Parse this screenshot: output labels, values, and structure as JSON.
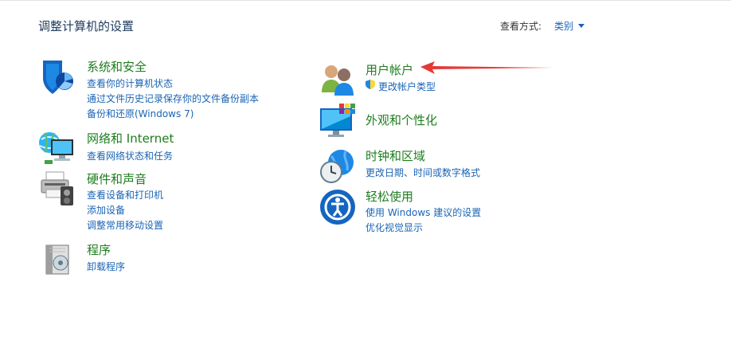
{
  "header": {
    "title": "调整计算机的设置",
    "view_by_label": "查看方式:",
    "view_by_value": "类别"
  },
  "categories": [
    {
      "title": "系统和安全",
      "icon": "shield-icon",
      "links": [
        "查看你的计算机状态",
        "通过文件历史记录保存你的文件备份副本",
        "备份和还原(Windows 7)"
      ]
    },
    {
      "title": "网络和 Internet",
      "icon": "network-icon",
      "links": [
        "查看网络状态和任务"
      ]
    },
    {
      "title": "硬件和声音",
      "icon": "printer-icon",
      "links": [
        "查看设备和打印机",
        "添加设备",
        "调整常用移动设置"
      ]
    },
    {
      "title": "程序",
      "icon": "programs-icon",
      "links": [
        "卸载程序"
      ]
    },
    {
      "title": "用户帐户",
      "icon": "users-icon",
      "links": [
        "更改帐户类型"
      ]
    },
    {
      "title": "外观和个性化",
      "icon": "monitor-icon",
      "links": []
    },
    {
      "title": "时钟和区域",
      "icon": "clock-globe-icon",
      "links": [
        "更改日期、时间或数字格式"
      ]
    },
    {
      "title": "轻松使用",
      "icon": "ease-of-access-icon",
      "links": [
        "使用 Windows 建议的设置",
        "优化视觉显示"
      ]
    }
  ],
  "colors": {
    "category_title": "#1e7d1e",
    "link": "#1a64b4",
    "annotation_arrow": "#e53935"
  }
}
